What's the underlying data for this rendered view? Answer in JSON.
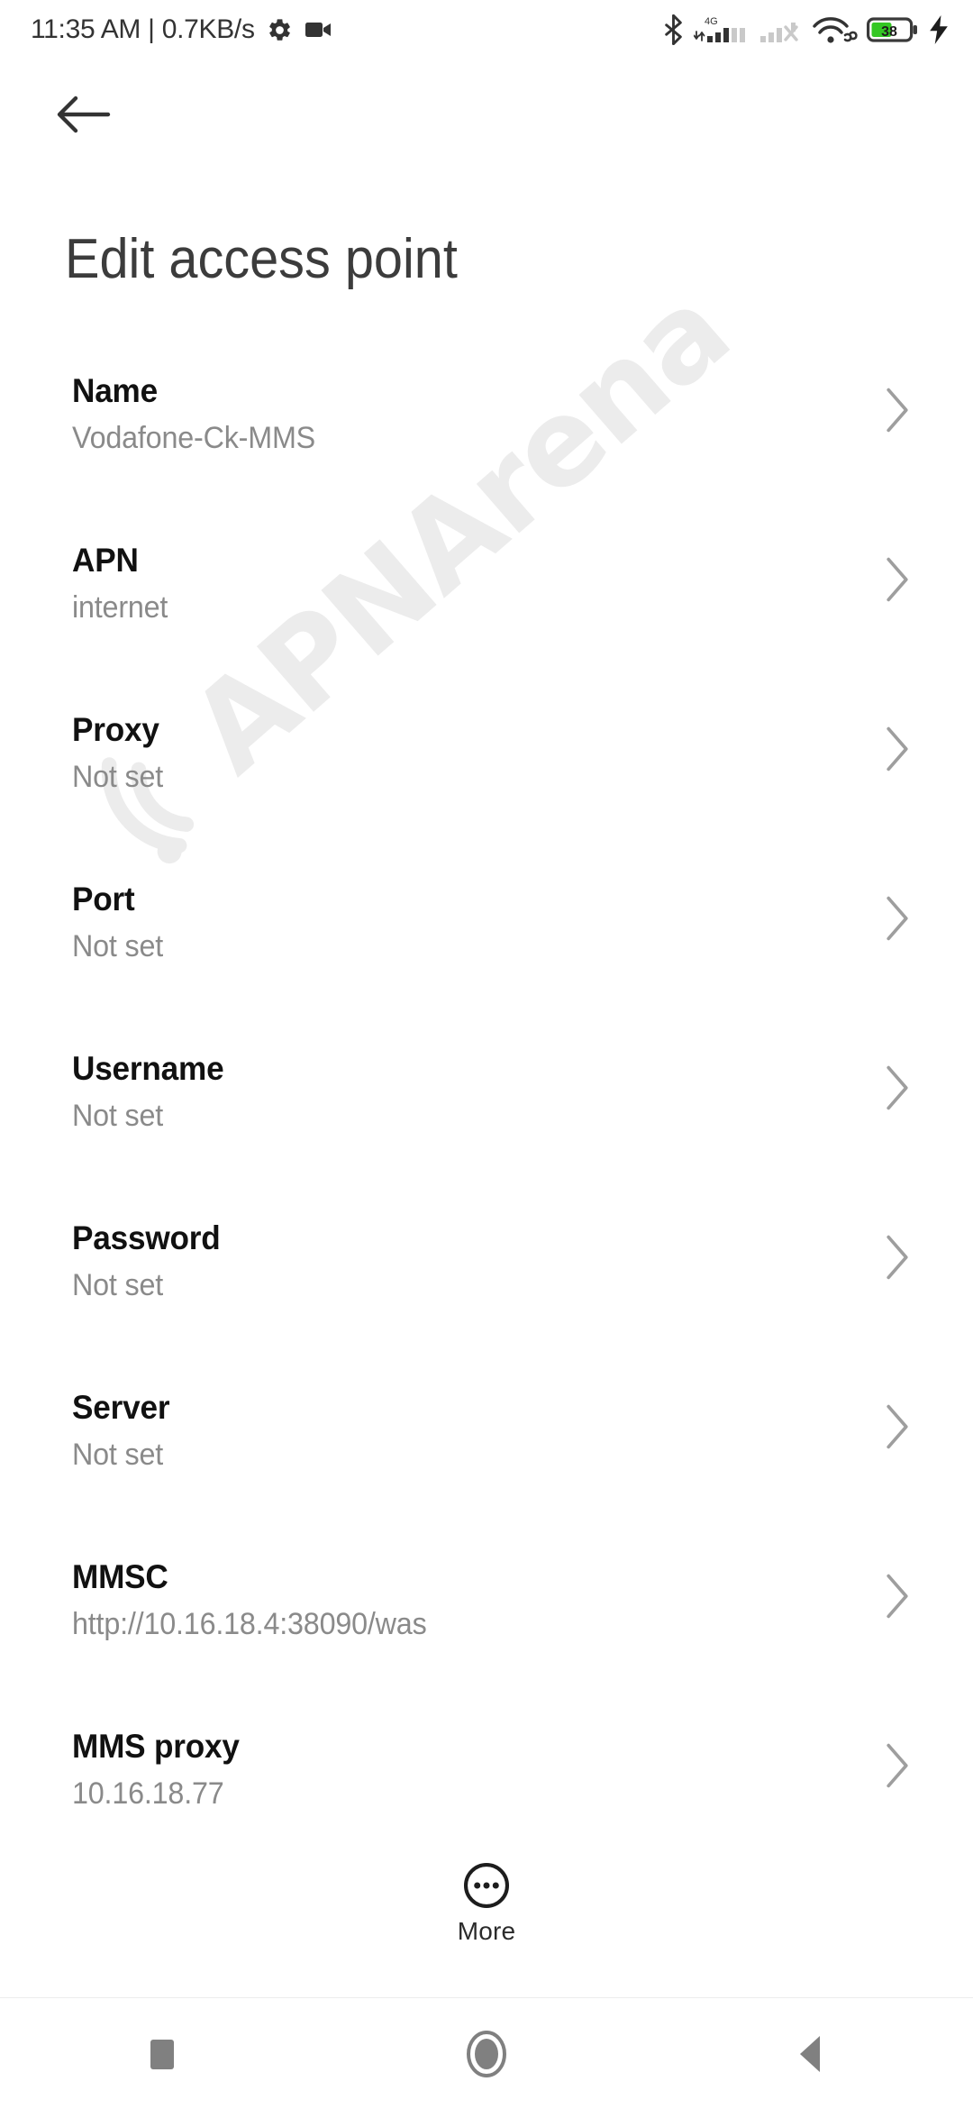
{
  "statusbar": {
    "clock": "11:35 AM | 0.7KB/s",
    "icons_left": [
      "gear-icon",
      "video-camera-icon"
    ],
    "icons_right": [
      "bluetooth-icon",
      "signal-4g-icon",
      "signal-no-service-icon",
      "wifi-link-icon",
      "battery-icon",
      "charging-bolt-icon"
    ],
    "network_type": "4G",
    "battery_percent": "38",
    "battery_color": "#34c724",
    "charging": true
  },
  "appbar": {
    "back_icon": "arrow-left-icon"
  },
  "header": {
    "title": "Edit access point"
  },
  "list": {
    "chevron_icon": "chevron-right-icon",
    "rows": [
      {
        "title": "Name",
        "value": "Vodafone-Ck-MMS"
      },
      {
        "title": "APN",
        "value": "internet"
      },
      {
        "title": "Proxy",
        "value": "Not set"
      },
      {
        "title": "Port",
        "value": "Not set"
      },
      {
        "title": "Username",
        "value": "Not set"
      },
      {
        "title": "Password",
        "value": "Not set"
      },
      {
        "title": "Server",
        "value": "Not set"
      },
      {
        "title": "MMSC",
        "value": "http://10.16.18.4:38090/was"
      },
      {
        "title": "MMS proxy",
        "value": "10.16.18.77"
      }
    ]
  },
  "more": {
    "label": "More",
    "icon": "more-circle-icon"
  },
  "navbar": {
    "recents_icon": "square-icon",
    "home_icon": "circle-icon",
    "back_icon": "triangle-left-icon"
  },
  "watermark": {
    "text": "APNArena",
    "color": "#ececec"
  },
  "colors": {
    "background": "#ffffff",
    "title_text": "#3c3c3c",
    "row_title": "#111111",
    "row_value": "#8a8a8a",
    "chevron": "#9e9e9e"
  }
}
